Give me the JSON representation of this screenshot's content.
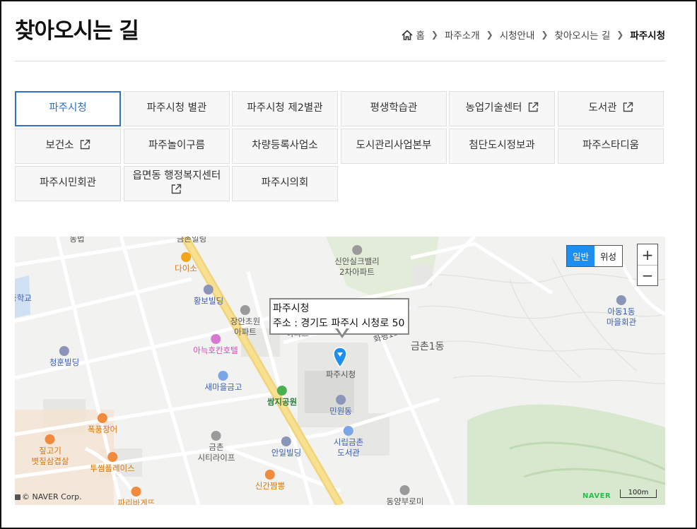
{
  "title": "찾아오시는 길",
  "breadcrumb": [
    "홈",
    "파주소개",
    "시청안내",
    "찾아오시는 길",
    "파주시청"
  ],
  "tabs": [
    {
      "label": "파주시청",
      "external": false,
      "active": true
    },
    {
      "label": "파주시청 별관",
      "external": false
    },
    {
      "label": "파주시청 제2별관",
      "external": false
    },
    {
      "label": "평생학습관",
      "external": false
    },
    {
      "label": "농업기술센터",
      "external": true
    },
    {
      "label": "도서관",
      "external": true
    },
    {
      "label": "보건소",
      "external": true
    },
    {
      "label": "파주놀이구름",
      "external": false
    },
    {
      "label": "차량등록사업소",
      "external": false
    },
    {
      "label": "도시관리사업본부",
      "external": false
    },
    {
      "label": "첨단도시정보과",
      "external": false
    },
    {
      "label": "파주스타디움",
      "external": false
    },
    {
      "label": "파주시민회관",
      "external": false
    },
    {
      "label": "읍면동 행정복지센터",
      "external": true
    },
    {
      "label": "파주시의회",
      "external": false
    }
  ],
  "map": {
    "type_buttons": [
      "일반",
      "위성"
    ],
    "selected_type": "일반",
    "zoom_in": "+",
    "zoom_out": "−",
    "info_title": "파주시청",
    "info_address": "주소 : 경기도 파주시 시청로 50",
    "copyright": "© NAVER Corp.",
    "brand": "NAVER",
    "scale": "100m",
    "area": "금촌1동",
    "road": "화평1로",
    "pois": [
      {
        "name": "금촌일링",
        "kind": "plain"
      },
      {
        "name": "다이소",
        "kind": "orange"
      },
      {
        "name": "신안실크밸리\n2차아파트",
        "kind": "plain"
      },
      {
        "name": "황보빌딩",
        "kind": "blue"
      },
      {
        "name": "장안초원\n아파트",
        "kind": "plain"
      },
      {
        "name": "장안미주\n아파트",
        "kind": "plain"
      },
      {
        "name": "아늑호칸호텔",
        "kind": "pink"
      },
      {
        "name": "청훈빌딩",
        "kind": "blue"
      },
      {
        "name": "새마을금고",
        "kind": "blue"
      },
      {
        "name": "쌈지공원",
        "kind": "green"
      },
      {
        "name": "파주시청",
        "kind": "plain"
      },
      {
        "name": "민원동",
        "kind": "blue"
      },
      {
        "name": "폭풍장어",
        "kind": "orange"
      },
      {
        "name": "짚고기\n볏짚삼겹살",
        "kind": "orange"
      },
      {
        "name": "투썸플레이스",
        "kind": "orange"
      },
      {
        "name": "금촌\n시티라이프",
        "kind": "plain"
      },
      {
        "name": "안일빌딩",
        "kind": "blue"
      },
      {
        "name": "시립금촌\n도서관",
        "kind": "blue"
      },
      {
        "name": "신간짬뽕",
        "kind": "orange"
      },
      {
        "name": "파리바게뜨",
        "kind": "orange"
      },
      {
        "name": "동양부로미",
        "kind": "plain"
      },
      {
        "name": "아동1동\n마을회관",
        "kind": "blue"
      },
      {
        "name": "동법",
        "kind": "orange"
      },
      {
        "name": "중학교",
        "kind": "blue"
      }
    ]
  },
  "colors": {
    "accent": "#2f6fc4",
    "map_button_on": "#1f8ef1",
    "naver_green": "#20c04a"
  }
}
